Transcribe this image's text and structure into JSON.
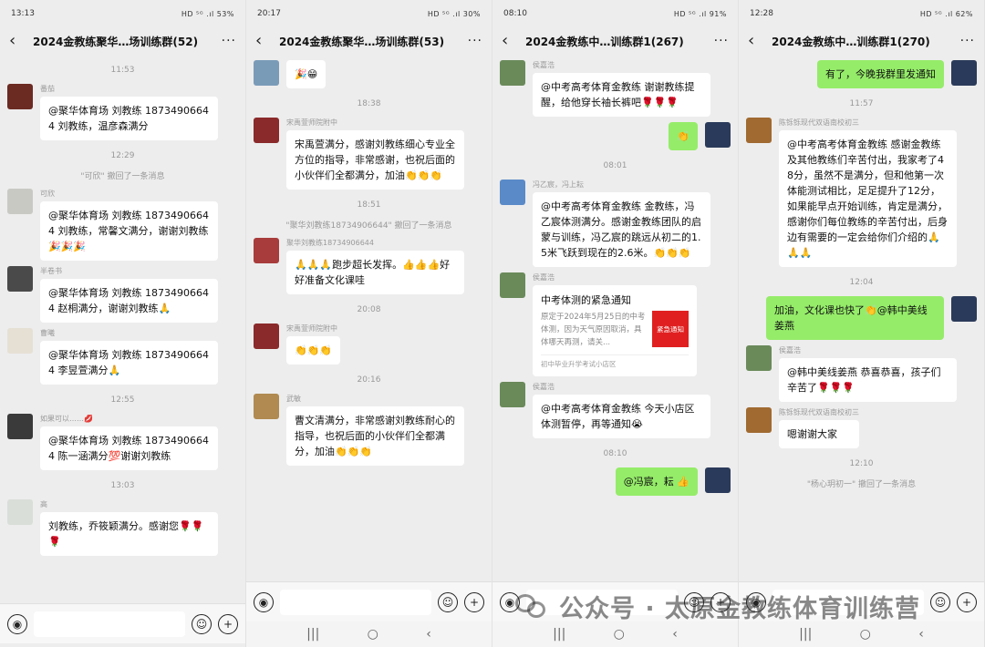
{
  "panels": [
    {
      "status": {
        "time": "13:13",
        "right": "HD ⁵ᴳ .ıl 53%"
      },
      "title": "2024金教练聚华…场训练群(52)",
      "items": [
        {
          "kind": "time",
          "text": "11:53"
        },
        {
          "kind": "msg",
          "nick": "番茄",
          "text": "@聚华体育场 刘教练 18734906644 刘教练，温彦森满分",
          "avatar": "#6b2a22"
        },
        {
          "kind": "time",
          "text": "12:29"
        },
        {
          "kind": "sys",
          "text": "\"可欣\" 撤回了一条消息"
        },
        {
          "kind": "msg",
          "nick": "可欣",
          "text": "@聚华体育场 刘教练 18734906644 刘教练，常馨文满分，谢谢刘教练🎉🎉🎉",
          "avatar": "#c9c9c4"
        },
        {
          "kind": "msg",
          "nick": "半卷书",
          "text": "@聚华体育场 刘教练 18734906644 赵桐满分，谢谢刘教练🙏",
          "avatar": "#4a4a4a"
        },
        {
          "kind": "msg",
          "nick": "曹曦",
          "text": "@聚华体育场 刘教练 18734906644 李昱萱满分🙏",
          "avatar": "#e6e0d4"
        },
        {
          "kind": "time",
          "text": "12:55"
        },
        {
          "kind": "msg",
          "nick": "如果可以……💋",
          "text": "@聚华体育场 刘教练 18734906644 陈一涵满分💯谢谢刘教练",
          "avatar": "#3a3a3a"
        },
        {
          "kind": "time",
          "text": "13:03"
        },
        {
          "kind": "msg",
          "nick": "高",
          "text": "刘教练，乔筱颖满分。感谢您🌹🌹🌹",
          "avatar": "#d9ded8"
        }
      ]
    },
    {
      "status": {
        "time": "20:17",
        "right": "HD ⁵ᴳ .ıl 30%"
      },
      "title": "2024金教练聚华…场训练群(53)",
      "items": [
        {
          "kind": "msg",
          "nick": "",
          "text": "🎉😁",
          "avatar": "#7a9bb8"
        },
        {
          "kind": "time",
          "text": "18:38"
        },
        {
          "kind": "msg",
          "nick": "宋禹萱师院附中",
          "text": "宋禹萱满分，感谢刘教练细心专业全方位的指导，非常感谢，也祝后面的小伙伴们全都满分，加油👏👏👏",
          "avatar": "#8a2a2a"
        },
        {
          "kind": "time",
          "text": "18:51"
        },
        {
          "kind": "sys",
          "text": "\"聚华刘教练18734906644\" 撤回了一条消息"
        },
        {
          "kind": "msg",
          "nick": "聚华刘教练18734906644",
          "text": "🙏🙏🙏跑步超长发挥。👍👍👍好好准备文化课哇",
          "avatar": "#a83c3c"
        },
        {
          "kind": "time",
          "text": "20:08"
        },
        {
          "kind": "msg",
          "nick": "宋禹萱师院附中",
          "text": "👏👏👏",
          "avatar": "#8a2a2a"
        },
        {
          "kind": "time",
          "text": "20:16"
        },
        {
          "kind": "msg",
          "nick": "武敏",
          "text": "曹文清满分，非常感谢刘教练耐心的指导，也祝后面的小伙伴们全都满分，加油👏👏👏",
          "avatar": "#b08a50"
        }
      ]
    },
    {
      "status": {
        "time": "08:10",
        "right": "HD ⁵ᴳ .ıl 91%"
      },
      "title": "2024金教练中…训练群1(267)",
      "items": [
        {
          "kind": "msg",
          "nick": "侯嘉浩",
          "text": "@中考高考体育金教练 谢谢教练提醒，给他穿长袖长裤吧🌹🌹🌹",
          "avatar": "#6a8a5a"
        },
        {
          "kind": "me",
          "text": "👏",
          "avatar": "#2a3a5a"
        },
        {
          "kind": "time",
          "text": "08:01"
        },
        {
          "kind": "msg",
          "nick": "冯乙宸，冯上耘",
          "text": "@中考高考体育金教练 金教练，冯乙宸体测满分。感谢金教练团队的启蒙与训练，冯乙宸的跳远从初二的1.5米飞跃到现在的2.6米。👏👏👏",
          "avatar": "#5a8ac8"
        },
        {
          "kind": "card",
          "nick": "侯嘉浩",
          "title": "中考体测的紧急通知",
          "desc": "原定于2024年5月25日的中考体测，因为天气原因取消，具体哪天再测，请关...",
          "thumb": "紧急通知",
          "source": "初中毕业升学考试小店区",
          "avatar": "#6a8a5a"
        },
        {
          "kind": "msg",
          "nick": "侯嘉浩",
          "text": "@中考高考体育金教练 今天小店区体测暂停，再等通知😭",
          "avatar": "#6a8a5a"
        },
        {
          "kind": "time",
          "text": "08:10"
        },
        {
          "kind": "me",
          "text": "@冯宸，耘 👍",
          "avatar": "#2a3a5a"
        }
      ]
    },
    {
      "status": {
        "time": "12:28",
        "right": "HD ⁵ᴳ .ıl 62%"
      },
      "title": "2024金教练中…训练群1(270)",
      "items": [
        {
          "kind": "me",
          "text": "有了，今晚我群里发通知",
          "avatar": "#2a3a5a"
        },
        {
          "kind": "time",
          "text": "11:57"
        },
        {
          "kind": "msg",
          "nick": "陈铄铄现代双语南校初三",
          "text": "@中考高考体育金教练 感谢金教练及其他教练们辛苦付出，我家考了48分，虽然不是满分，但和他第一次体能测试相比，足足提升了12分，如果能早点开始训练，肯定是满分，感谢你们每位教练的辛苦付出，后身边有需要的一定会给你们介绍的🙏🙏🙏",
          "avatar": "#a06a30"
        },
        {
          "kind": "time",
          "text": "12:04"
        },
        {
          "kind": "me",
          "text": "加油，文化课也快了👏@韩中美线姜燕",
          "avatar": "#2a3a5a"
        },
        {
          "kind": "msg",
          "nick": "侯嘉浩",
          "text": "@韩中美线姜燕 恭喜恭喜，孩子们辛苦了🌹🌹🌹",
          "avatar": "#6a8a5a"
        },
        {
          "kind": "msg",
          "nick": "陈铄铄现代双语南校初三",
          "text": "嗯谢谢大家",
          "avatar": "#a06a30"
        },
        {
          "kind": "time",
          "text": "12:10"
        },
        {
          "kind": "sys",
          "text": "\"杨心玥初一\" 撤回了一条消息"
        }
      ]
    }
  ],
  "icons": {
    "back": "‹",
    "more": "···",
    "voice": "◉",
    "emoji": "☺",
    "plus": "+"
  },
  "watermark": {
    "text": "公众号 · 太原金教练体育训练营"
  },
  "homebar": {
    "recent": "|||",
    "home": "○",
    "back": "‹"
  }
}
